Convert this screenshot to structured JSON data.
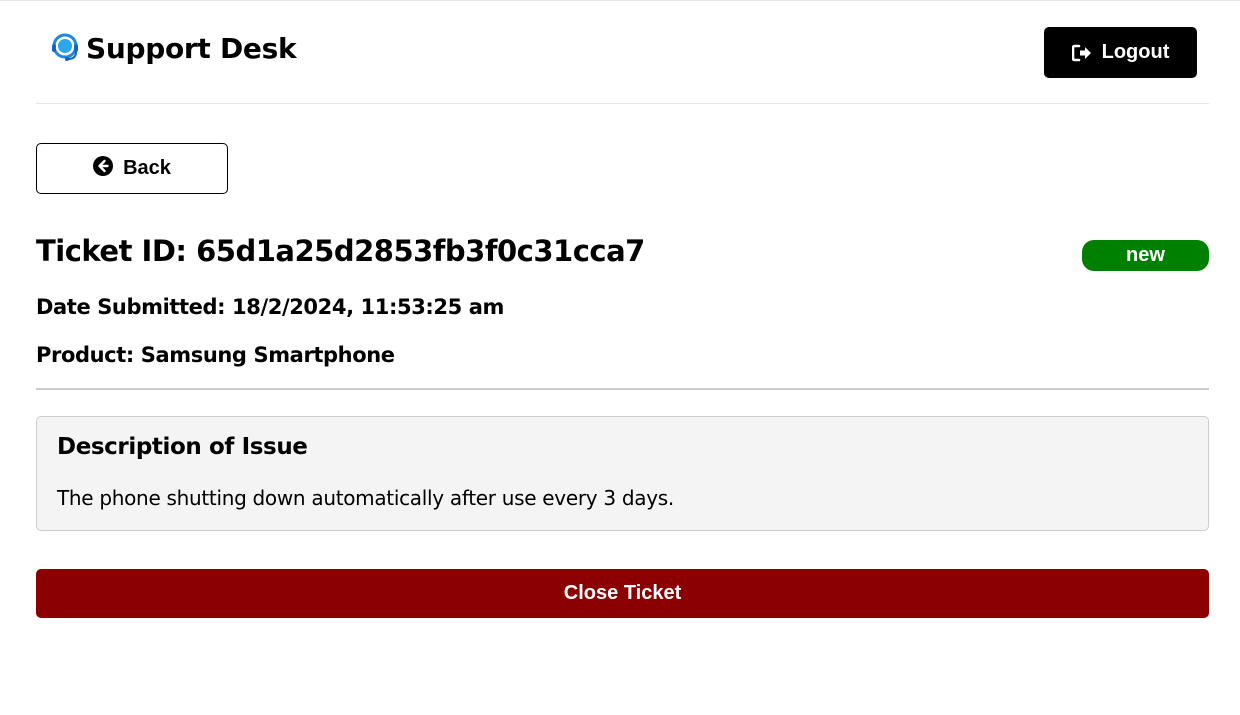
{
  "header": {
    "app_title": "Support Desk",
    "logo_icon": "headset-icon",
    "logout_label": "Logout",
    "logout_icon": "sign-out-icon"
  },
  "back": {
    "label": "Back",
    "icon": "arrow-circle-left-icon"
  },
  "ticket": {
    "id_text": "Ticket ID: 65d1a25d2853fb3f0c31cca7",
    "status": "new",
    "date_text": "Date Submitted: 18/2/2024, 11:53:25 am",
    "product_text": "Product: Samsung Smartphone"
  },
  "description": {
    "heading": "Description of Issue",
    "text": "The phone shutting down automatically after use every 3 days."
  },
  "actions": {
    "close_label": "Close Ticket"
  },
  "colors": {
    "status_new": "#008000",
    "close_button": "#8b0000",
    "logo_blue": "#1e88e5",
    "primary": "#000000"
  }
}
